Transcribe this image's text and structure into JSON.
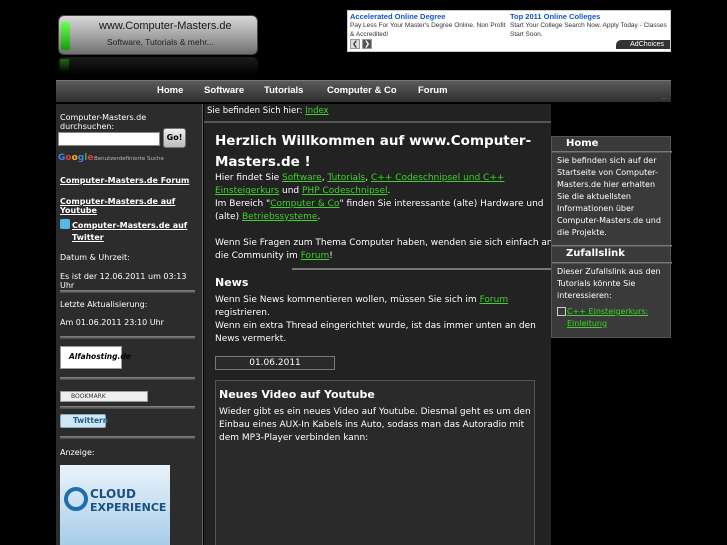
{
  "header": {
    "logo_title": "www.Computer-Masters.de",
    "logo_subtitle": "Software, Tutorials & mehr..."
  },
  "ads": {
    "ad1_title": "Accelerated Online Degree",
    "ad1_body": "Pay Less For Your Master's Degree Online. Non Profit & Accredited!",
    "ad2_title": "Top 2011 Online Colleges",
    "ad2_body": "Start Your College Search Now. Apply Today - Classes Start Soon.",
    "adchoices": "AdChoices"
  },
  "nav": {
    "items": [
      "Home",
      "Software",
      "Tutorials",
      "Computer & Co",
      "Forum"
    ],
    "small_link": "..."
  },
  "sidebar": {
    "search_label": "Computer-Masters.de durchsuchen:",
    "search_value": "",
    "search_button": "Go!",
    "google_logo": "Google",
    "google_sub": "Benutzerdefinierte Suche",
    "link_forum": "Computer-Masters.de Forum",
    "link_youtube": "Computer-Masters.de auf Youtube",
    "link_twitter": "Computer-Masters.de auf Twitter",
    "date_label": "Datum & Uhrzeit:",
    "date_value": "Es ist der 12.06.2011 um 03:13 Uhr",
    "update_label": "Letzte Aktualisierung:",
    "update_value": "Am 01.06.2011 23:10 Uhr",
    "alfahosting": "Alfahosting.de",
    "bookmark": "BOOKMARK",
    "twitter_button": "Twittern",
    "ad_label": "Anzeige:",
    "cloud_line1": "CLOUD",
    "cloud_line2": "EXPERIENCE"
  },
  "main": {
    "breadcrumb_prefix": "Sie befinden Sich hier:",
    "breadcrumb_link": "Index",
    "welcome_title": "Herzlich Willkommen auf www.Computer-Masters.de !",
    "intro_1": "Hier findet Sie",
    "intro_software": "Software",
    "intro_tutorials": "Tutorials",
    "intro_cpp": "C++ Codeschnipsel und C++ Einsteigerkurs",
    "intro_und": "und",
    "intro_php": "PHP Codeschnipsel",
    "intro_2a": "Im Bereich \"",
    "intro_computer": "Computer & Co",
    "intro_2b": "\" finden Sie interessante (alte) Hardware und (alte)",
    "intro_os": "Betriebssysteme",
    "questions_a": "Wenn Sie Fragen zum Thema Computer haben, wenden sie sich einfach an die Community im",
    "questions_forum": "Forum",
    "news_title": "News",
    "news_text_a": "Wenn Sie News kommentieren wollen, müssen Sie sich im",
    "news_forum": "Forum",
    "news_text_b": "registrieren.",
    "news_text_c": "Wenn ein extra Thread eingerichtet wurde, ist das immer unten an den News vermerkt.",
    "news_date": "01.06.2011",
    "post_title": "Neues Video auf Youtube",
    "post_body": "Wieder gibt es ein neues Video auf Youtube. Diesmal geht es um den Einbau eines AUX-In Kabels ins Auto, sodass man das Autoradio mit dem MP3-Player verbinden kann:"
  },
  "right": {
    "home_title": "Home",
    "home_text": "Sie befinden sich auf der Startseite von Computer-Masters.de hier erhalten Sie die aktuellsten Informationen über Computer-Masters.de und die Projekte.",
    "random_title": "Zufallslink",
    "random_text": "Dieser Zufallslink aus den Tutorials könnte Sie interessieren:",
    "random_link": "C++ Einsteigerkurs: Einleitung"
  }
}
